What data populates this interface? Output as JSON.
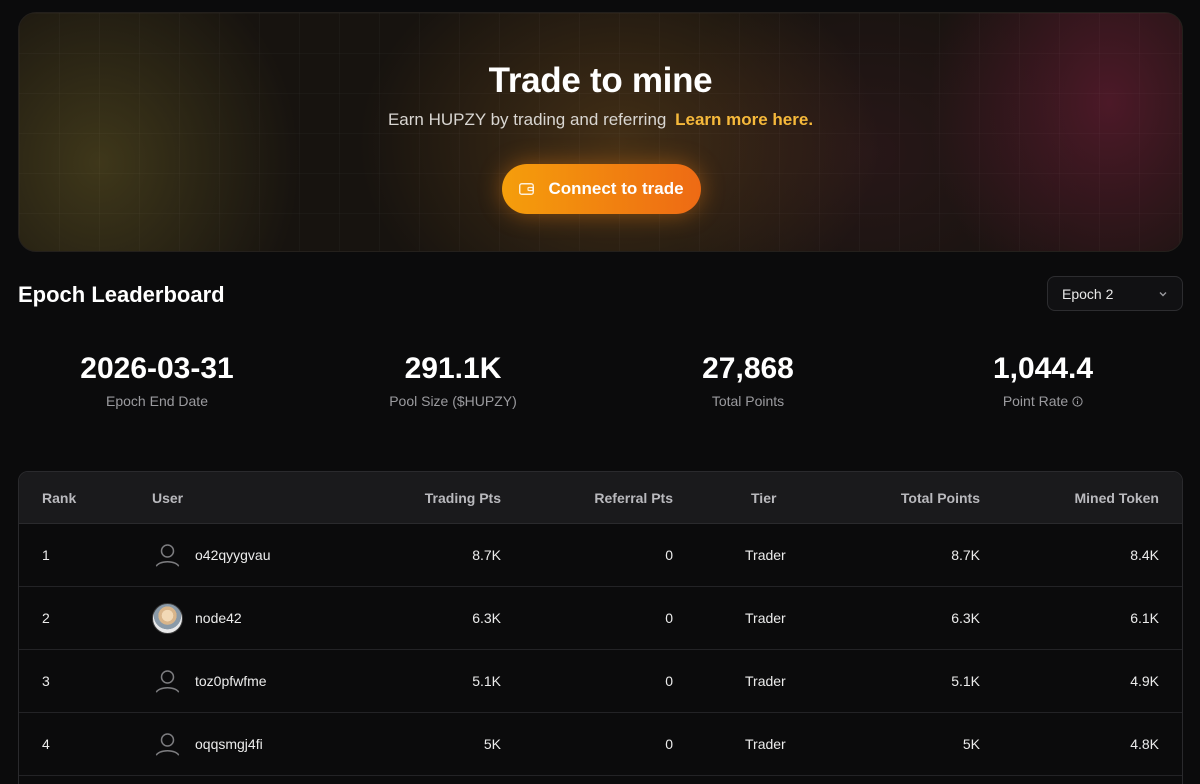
{
  "hero": {
    "title": "Trade to mine",
    "subtitle": "Earn HUPZY by trading and referring",
    "learn_more": "Learn more here.",
    "connect_label": "Connect to trade"
  },
  "leaderboard": {
    "title": "Epoch Leaderboard",
    "epoch_selected": "Epoch 2"
  },
  "stats": [
    {
      "value": "2026-03-31",
      "label": "Epoch End Date"
    },
    {
      "value": "291.1K",
      "label": "Pool Size ($HUPZY)"
    },
    {
      "value": "27,868",
      "label": "Total Points"
    },
    {
      "value": "1,044.4",
      "label": "Point Rate"
    }
  ],
  "table": {
    "headers": {
      "rank": "Rank",
      "user": "User",
      "trading": "Trading Pts",
      "referral": "Referral Pts",
      "tier": "Tier",
      "total": "Total Points",
      "mined": "Mined Token"
    },
    "rows": [
      {
        "rank": "1",
        "user": "o42qyygvau",
        "trading": "8.7K",
        "referral": "0",
        "tier": "Trader",
        "total": "8.7K",
        "mined": "8.4K",
        "avatar": "default-user-icon"
      },
      {
        "rank": "2",
        "user": "node42",
        "trading": "6.3K",
        "referral": "0",
        "tier": "Trader",
        "total": "6.3K",
        "mined": "6.1K",
        "avatar": "photo-avatar"
      },
      {
        "rank": "3",
        "user": "toz0pfwfme",
        "trading": "5.1K",
        "referral": "0",
        "tier": "Trader",
        "total": "5.1K",
        "mined": "4.9K",
        "avatar": "default-user-icon"
      },
      {
        "rank": "4",
        "user": "oqqsmgj4fi",
        "trading": "5K",
        "referral": "0",
        "tier": "Trader",
        "total": "5K",
        "mined": "4.8K",
        "avatar": "default-user-icon"
      }
    ]
  },
  "colors": {
    "accent": "#f59e0b",
    "accent_end": "#ee6a14",
    "link": "#f6b93b",
    "background": "#0b0b0c"
  }
}
